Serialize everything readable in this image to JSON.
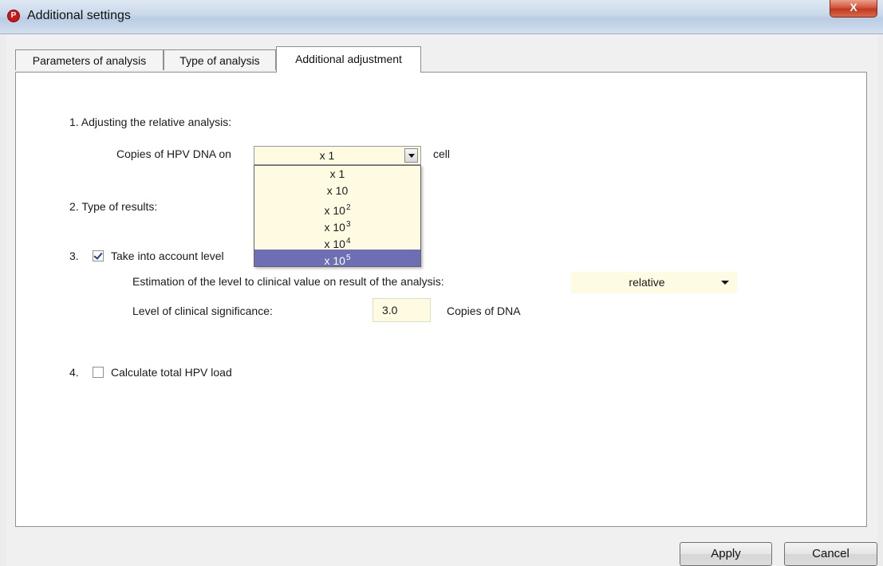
{
  "window": {
    "title": "Additional settings",
    "close_label": "X",
    "app_icon": "P"
  },
  "tabs": [
    {
      "label": "Parameters of analysis"
    },
    {
      "label": "Type of analysis"
    },
    {
      "label": "Additional adjustment"
    }
  ],
  "section1": {
    "heading": "1. Adjusting the relative analysis:",
    "copies_label": "Copies of HPV DNA on",
    "selected_value": "x 1",
    "suffix": "cell",
    "dropdown_options": [
      {
        "base": "x 1",
        "exp": ""
      },
      {
        "base": "x 10",
        "exp": ""
      },
      {
        "base": "x 10",
        "exp": "2"
      },
      {
        "base": "x 10",
        "exp": "3"
      },
      {
        "base": "x 10",
        "exp": "4"
      },
      {
        "base": "x 10",
        "exp": "5"
      }
    ],
    "highlighted_option": "x 10 5"
  },
  "section2": {
    "heading": "2. Type of results:"
  },
  "section3": {
    "number": "3.",
    "checkbox_label": "Take into account level",
    "checked": true,
    "estimation_label": "Estimation of the level to clinical value on result of the analysis:",
    "estimation_value": "relative",
    "significance_label": "Level of clinical significance:",
    "significance_value": "3.0",
    "significance_unit": "Copies of DNA"
  },
  "section4": {
    "number": "4.",
    "checkbox_label": "Calculate total HPV load",
    "checked": false
  },
  "footer": {
    "apply_label": "Apply",
    "cancel_label": "Cancel"
  },
  "colors": {
    "field_bg": "#fffbe3",
    "highlight": "#6e6eb4",
    "close_red": "#c13a1f"
  }
}
